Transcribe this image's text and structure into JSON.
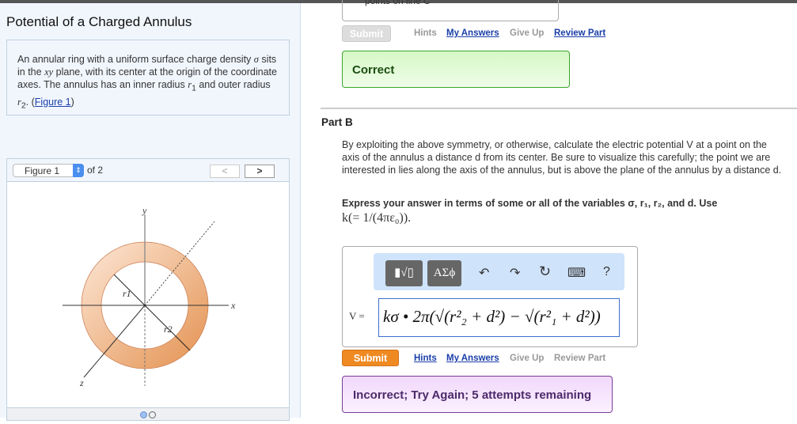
{
  "left": {
    "title": "Potential of a Charged Annulus",
    "intro": {
      "t1": "An annular ring with a uniform surface charge density ",
      "sigma": "σ",
      "t2": " sits in the ",
      "xy": "xy",
      "t3": " plane, with its center at the origin of the coordinate axes. The annulus has an inner radius ",
      "r1": "r",
      "sub1": "1",
      "t4": " and outer radius ",
      "r2": "r",
      "sub2": "2",
      "t5": ". (",
      "link": "Figure 1",
      "t6": ")"
    },
    "figure": {
      "select": "Figure 1",
      "of": "of 2",
      "prev": "<",
      "next": ">",
      "labels": {
        "y": "y",
        "x": "x",
        "z": "z",
        "r1": "r1",
        "r2": "r2"
      },
      "page": 1,
      "pages": 2
    }
  },
  "partA": {
    "option": "points on line C",
    "submit": "Submit",
    "hints": "Hints",
    "my_answers": "My Answers",
    "give_up": "Give Up",
    "review": "Review Part",
    "feedback": "Correct"
  },
  "partB": {
    "title": "Part B",
    "q": "By exploiting the above symmetry, or otherwise, calculate the electric potential V at a point on the axis of the annulus a distance d from its center. Be sure to visualize this carefully; the point we are interested in lies along the axis of the annulus, but is above the plane of the annulus by a distance d.",
    "express": "Express your answer in terms of some or all of the variables σ, r₁, r₂, and d. Use",
    "k": "k(= 1/(4πε₀)).",
    "toolbar": {
      "templates": "▮√▯",
      "greek": "ΑΣϕ",
      "undo": "↶",
      "redo": "↷",
      "reset": "↻",
      "keyboard": "⌨",
      "help": "?"
    },
    "var": "V =",
    "answer": "kσ • 2π(√(r²₂ + d²) − √(r²₁ + d²))",
    "submit": "Submit",
    "hints": "Hints",
    "my_answers": "My Answers",
    "give_up": "Give Up",
    "review": "Review Part",
    "feedback": "Incorrect; Try Again; 5 attempts remaining"
  },
  "colors": {
    "submit": "#ef8a22",
    "correct_bg": "#dff9d2",
    "incorrect_bg": "#f3dcfb",
    "link": "#1a3ea8"
  }
}
